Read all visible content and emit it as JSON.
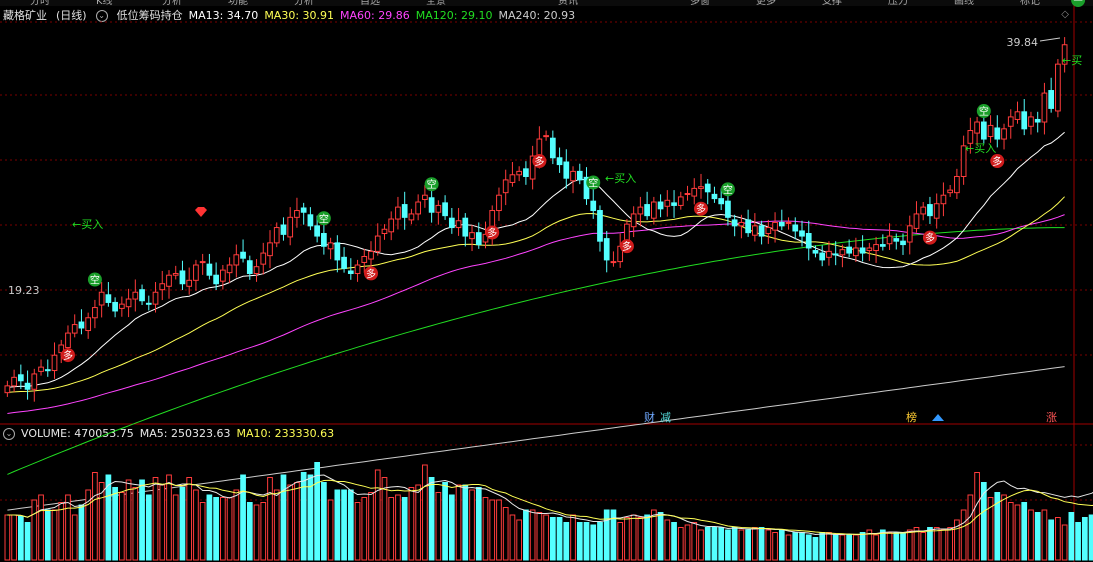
{
  "toolbar": {
    "buttons": [
      "分时",
      "K线",
      "分析",
      "功能",
      "分析",
      "自选",
      "全景",
      "F10",
      "资讯",
      "F10",
      "多窗",
      "更多",
      "支撑",
      "压力",
      "画线",
      "标记"
    ]
  },
  "header": {
    "stock": "藏格矿业",
    "period": "(日线)",
    "indicator": "低位筹码持仓",
    "settings_icon": "diamond-icon"
  },
  "ma_legend": [
    {
      "label": "MA13: 34.70",
      "color": "#ffffff"
    },
    {
      "label": "MA30: 30.91",
      "color": "#ffff55"
    },
    {
      "label": "MA60: 29.86",
      "color": "#ff44ff"
    },
    {
      "label": "MA120: 29.10",
      "color": "#22dd22"
    },
    {
      "label": "MA240: 20.93",
      "color": "#cccccc"
    }
  ],
  "vol_legend": [
    {
      "label": "VOLUME: 470053.75",
      "color": "#e8e8e8"
    },
    {
      "label": "MA5: 250323.63",
      "color": "#e8e8e8"
    },
    {
      "label": "MA10: 233330.63",
      "color": "#ffff55"
    }
  ],
  "annotations": {
    "high_price": "39.84",
    "low_price": "19.23",
    "buy": "买",
    "buy_in": "买入",
    "kong": "空",
    "duo": "多",
    "cai": "财",
    "jian": "减",
    "bang": "榜",
    "zhang": "涨"
  },
  "colors": {
    "up": "#ff3c3c",
    "down": "#54ffff",
    "ma13": "#ffffff",
    "ma30": "#ffff55",
    "ma60": "#ff44ff",
    "ma120": "#22dd22",
    "ma240": "#cccccc",
    "grid": "#7a0000"
  },
  "chart_data": {
    "type": "candlestick",
    "title": "藏格矿业 (日线)",
    "ylim": [
      17.5,
      41
    ],
    "grid": true,
    "ma_last": {
      "MA13": 34.7,
      "MA30": 30.91,
      "MA60": 29.86,
      "MA120": 29.1,
      "MA240": 20.93
    },
    "series_close": [
      19.8,
      20.3,
      20.1,
      19.6,
      20.5,
      20.9,
      20.7,
      21.6,
      22.2,
      22.9,
      23.4,
      23.2,
      23.8,
      24.4,
      25.3,
      24.7,
      24.2,
      24.6,
      24.9,
      25.3,
      24.8,
      24.6,
      25.3,
      25.8,
      26.3,
      26.4,
      25.8,
      26.0,
      26.9,
      27.1,
      26.3,
      25.8,
      26.6,
      26.9,
      27.5,
      27.3,
      26.4,
      26.8,
      27.6,
      28.2,
      29.1,
      28.7,
      29.7,
      30.1,
      30.0,
      29.2,
      28.6,
      28.0,
      28.2,
      27.2,
      26.7,
      26.4,
      26.9,
      27.4,
      27.7,
      28.6,
      29.0,
      29.6,
      30.3,
      29.7,
      29.9,
      30.6,
      31.0,
      30.0,
      30.4,
      29.8,
      29.1,
      29.5,
      28.6,
      28.8,
      28.1,
      28.7,
      30.1,
      31.0,
      31.9,
      32.2,
      32.4,
      32.1,
      33.3,
      34.3,
      34.5,
      33.2,
      32.8,
      32.0,
      32.4,
      31.9,
      30.8,
      30.1,
      28.3,
      27.2,
      27.1,
      28.0,
      29.3,
      29.9,
      30.3,
      29.8,
      30.6,
      30.2,
      30.7,
      30.4,
      30.9,
      31.1,
      31.4,
      31.5,
      31.2,
      30.8,
      30.5,
      29.7,
      29.2,
      29.4,
      28.8,
      29.2,
      28.6,
      29.1,
      29.4,
      29.2,
      29.4,
      28.9,
      28.6,
      27.9,
      27.6,
      27.2,
      27.7,
      27.5,
      27.8,
      27.6,
      27.9,
      27.6,
      27.9,
      28.1,
      28.0,
      28.6,
      28.3,
      28.1,
      29.2,
      29.9,
      30.3,
      29.8,
      30.5,
      31.0,
      31.3,
      32.1,
      33.9,
      34.8,
      35.3,
      34.3,
      35.1,
      34.3,
      34.9,
      35.6,
      35.9,
      34.9,
      35.6,
      35.3,
      37.0,
      36.1,
      38.7,
      39.84
    ],
    "volume": {
      "ylim": [
        0,
        480000
      ],
      "values": [
        180000,
        180000,
        175000,
        150000,
        240000,
        260000,
        200000,
        200000,
        230000,
        260000,
        180000,
        220000,
        280000,
        350000,
        310000,
        340000,
        290000,
        270000,
        320000,
        290000,
        320000,
        260000,
        330000,
        300000,
        340000,
        260000,
        290000,
        330000,
        280000,
        230000,
        260000,
        250000,
        250000,
        250000,
        280000,
        340000,
        230000,
        220000,
        230000,
        330000,
        280000,
        340000,
        300000,
        310000,
        350000,
        340000,
        390000,
        310000,
        240000,
        280000,
        280000,
        280000,
        230000,
        250000,
        270000,
        360000,
        330000,
        250000,
        260000,
        250000,
        290000,
        300000,
        380000,
        330000,
        270000,
        310000,
        260000,
        300000,
        300000,
        280000,
        290000,
        250000,
        240000,
        240000,
        210000,
        180000,
        160000,
        200000,
        200000,
        190000,
        180000,
        170000,
        170000,
        150000,
        180000,
        150000,
        150000,
        140000,
        150000,
        200000,
        200000,
        150000,
        170000,
        180000,
        170000,
        180000,
        200000,
        190000,
        160000,
        150000,
        130000,
        140000,
        150000,
        120000,
        130000,
        130000,
        130000,
        120000,
        130000,
        120000,
        120000,
        130000,
        130000,
        120000,
        110000,
        120000,
        100000,
        110000,
        110000,
        100000,
        90000,
        110000,
        110000,
        100000,
        100000,
        100000,
        100000,
        110000,
        120000,
        100000,
        120000,
        110000,
        110000,
        110000,
        120000,
        130000,
        110000,
        130000,
        130000,
        120000,
        130000,
        160000,
        200000,
        260000,
        350000,
        310000,
        250000,
        270000,
        260000,
        230000,
        220000,
        230000,
        200000,
        190000,
        200000,
        160000,
        170000,
        140000,
        190000,
        150000,
        170000,
        180000,
        190000,
        470053.75
      ],
      "ma5_last": 250323.63,
      "ma10_last": 233330.63
    }
  }
}
